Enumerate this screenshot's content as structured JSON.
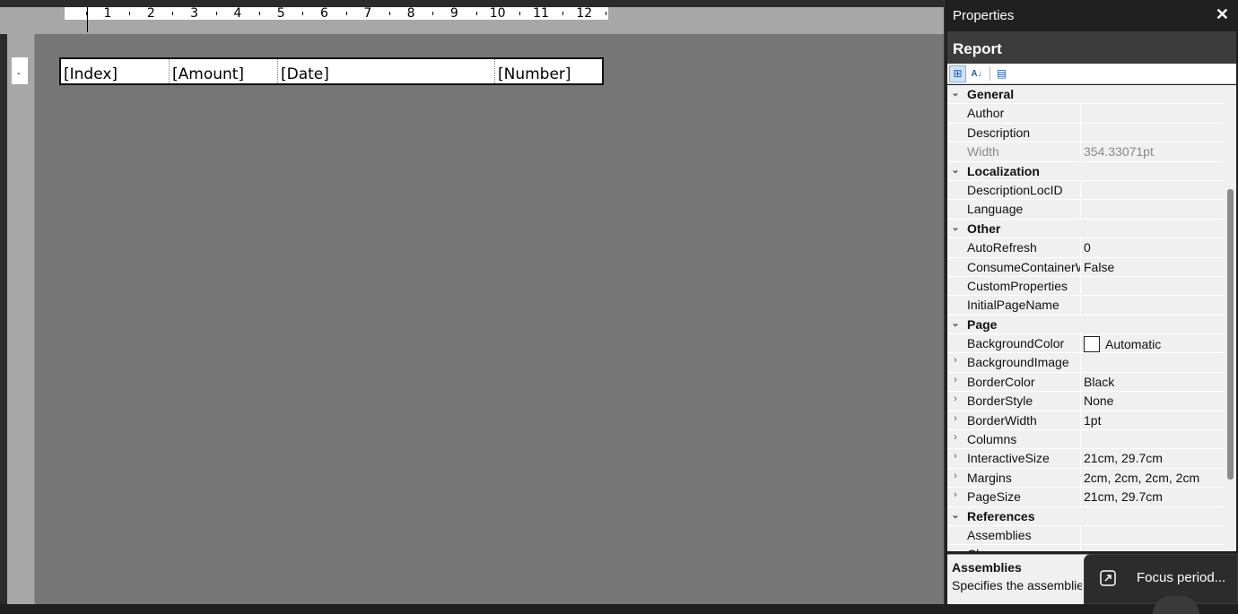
{
  "designer": {
    "ruler_numbers": [
      "1",
      "2",
      "3",
      "4",
      "5",
      "6",
      "7",
      "8",
      "9",
      "10",
      "11",
      "12"
    ],
    "mini_box_text": "-",
    "table_cells": [
      "[Index]",
      "[Amount]",
      "[Date]",
      "[Number]"
    ]
  },
  "properties": {
    "title": "Properties",
    "close_glyph": "✕",
    "object_name": "Report",
    "toolbar": {
      "categorized_icon": "⊞",
      "alphabetical_icon": "A↓",
      "property_pages_icon": "▤"
    },
    "rows": [
      {
        "type": "cat",
        "expander": "⌄",
        "name": "General"
      },
      {
        "type": "prop",
        "expander": "",
        "name": "Author",
        "value": ""
      },
      {
        "type": "prop",
        "expander": "",
        "name": "Description",
        "value": ""
      },
      {
        "type": "prop",
        "expander": "",
        "name": "Width",
        "value": "354.33071pt",
        "disabled": true
      },
      {
        "type": "cat",
        "expander": "⌄",
        "name": "Localization"
      },
      {
        "type": "prop",
        "expander": "",
        "name": "DescriptionLocID",
        "value": ""
      },
      {
        "type": "prop",
        "expander": "",
        "name": "Language",
        "value": ""
      },
      {
        "type": "cat",
        "expander": "⌄",
        "name": "Other"
      },
      {
        "type": "prop",
        "expander": "",
        "name": "AutoRefresh",
        "value": "0"
      },
      {
        "type": "prop",
        "expander": "",
        "name": "ConsumeContainerWhitespace",
        "value": "False"
      },
      {
        "type": "prop",
        "expander": "",
        "name": "CustomProperties",
        "value": ""
      },
      {
        "type": "prop",
        "expander": "",
        "name": "InitialPageName",
        "value": ""
      },
      {
        "type": "cat",
        "expander": "⌄",
        "name": "Page"
      },
      {
        "type": "prop",
        "expander": "",
        "name": "BackgroundColor",
        "value": "Automatic",
        "swatch": true
      },
      {
        "type": "prop",
        "expander": "›",
        "name": "BackgroundImage",
        "value": ""
      },
      {
        "type": "prop",
        "expander": "›",
        "name": "BorderColor",
        "value": "Black"
      },
      {
        "type": "prop",
        "expander": "›",
        "name": "BorderStyle",
        "value": "None"
      },
      {
        "type": "prop",
        "expander": "›",
        "name": "BorderWidth",
        "value": "1pt"
      },
      {
        "type": "prop",
        "expander": "›",
        "name": "Columns",
        "value": ""
      },
      {
        "type": "prop",
        "expander": "›",
        "name": "InteractiveSize",
        "value": "21cm, 29.7cm"
      },
      {
        "type": "prop",
        "expander": "›",
        "name": "Margins",
        "value": "2cm, 2cm, 2cm, 2cm"
      },
      {
        "type": "prop",
        "expander": "›",
        "name": "PageSize",
        "value": "21cm, 29.7cm"
      },
      {
        "type": "cat",
        "expander": "⌄",
        "name": "References"
      },
      {
        "type": "prop",
        "expander": "",
        "name": "Assemblies",
        "value": ""
      },
      {
        "type": "prop",
        "expander": "",
        "name": "Cl",
        "value": ""
      }
    ],
    "description": {
      "title": "Assemblies",
      "text": "Specifies the assemblies"
    }
  },
  "toast": {
    "text": "Focus period..."
  },
  "colors": {
    "designer_bg": "#767676",
    "panel_bg": "#202020",
    "grid_bg": "#f0f0f0"
  }
}
